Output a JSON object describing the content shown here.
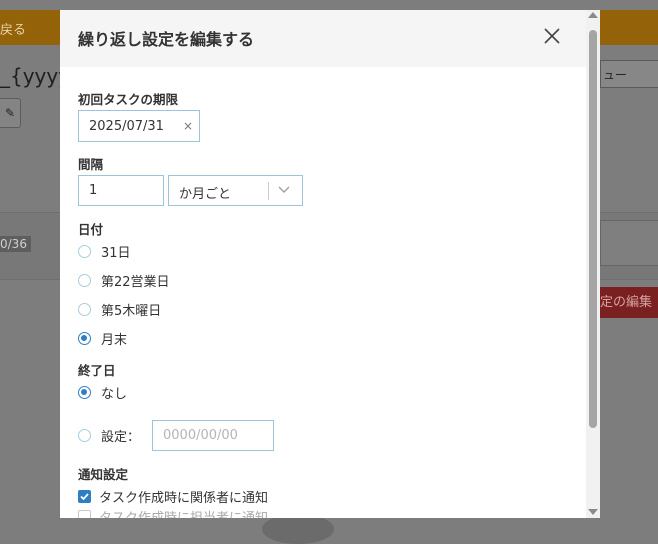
{
  "background": {
    "back_label": "戻る",
    "page_title": "_{yyyy",
    "menu_label": "ュー",
    "count_badge": "0/36",
    "edit_button_label": "定の編集"
  },
  "modal": {
    "title": "繰り返し設定を編集する",
    "first_due": {
      "label": "初回タスクの期限",
      "value": "2025/07/31",
      "clear_symbol": "×"
    },
    "interval": {
      "label": "間隔",
      "value": "1",
      "unit": "か月ごと"
    },
    "day": {
      "label": "日付",
      "options": [
        {
          "label": "31日",
          "checked": false
        },
        {
          "label": "第22営業日",
          "checked": false
        },
        {
          "label": "第5木曜日",
          "checked": false
        },
        {
          "label": "月末",
          "checked": true
        }
      ]
    },
    "end_date": {
      "label": "終了日",
      "options": [
        {
          "label": "なし",
          "checked": true
        },
        {
          "label": "設定：",
          "checked": false
        }
      ],
      "placeholder": "0000/00/00"
    },
    "notification": {
      "label": "通知設定",
      "options": [
        {
          "label": "タスク作成時に関係者に通知",
          "checked": true
        },
        {
          "label": "タスク作成時に担当者に通知",
          "checked": false
        }
      ]
    }
  },
  "colors": {
    "accent": "#2e7ec4",
    "input_border": "#9cc5db",
    "header_bg": "#f5f5f5",
    "overlay": "#7d7d7d"
  },
  "icons": {
    "close": "close-icon",
    "chevron": "chevron-down-icon",
    "pencil": "pencil-icon",
    "check": "check-icon"
  }
}
